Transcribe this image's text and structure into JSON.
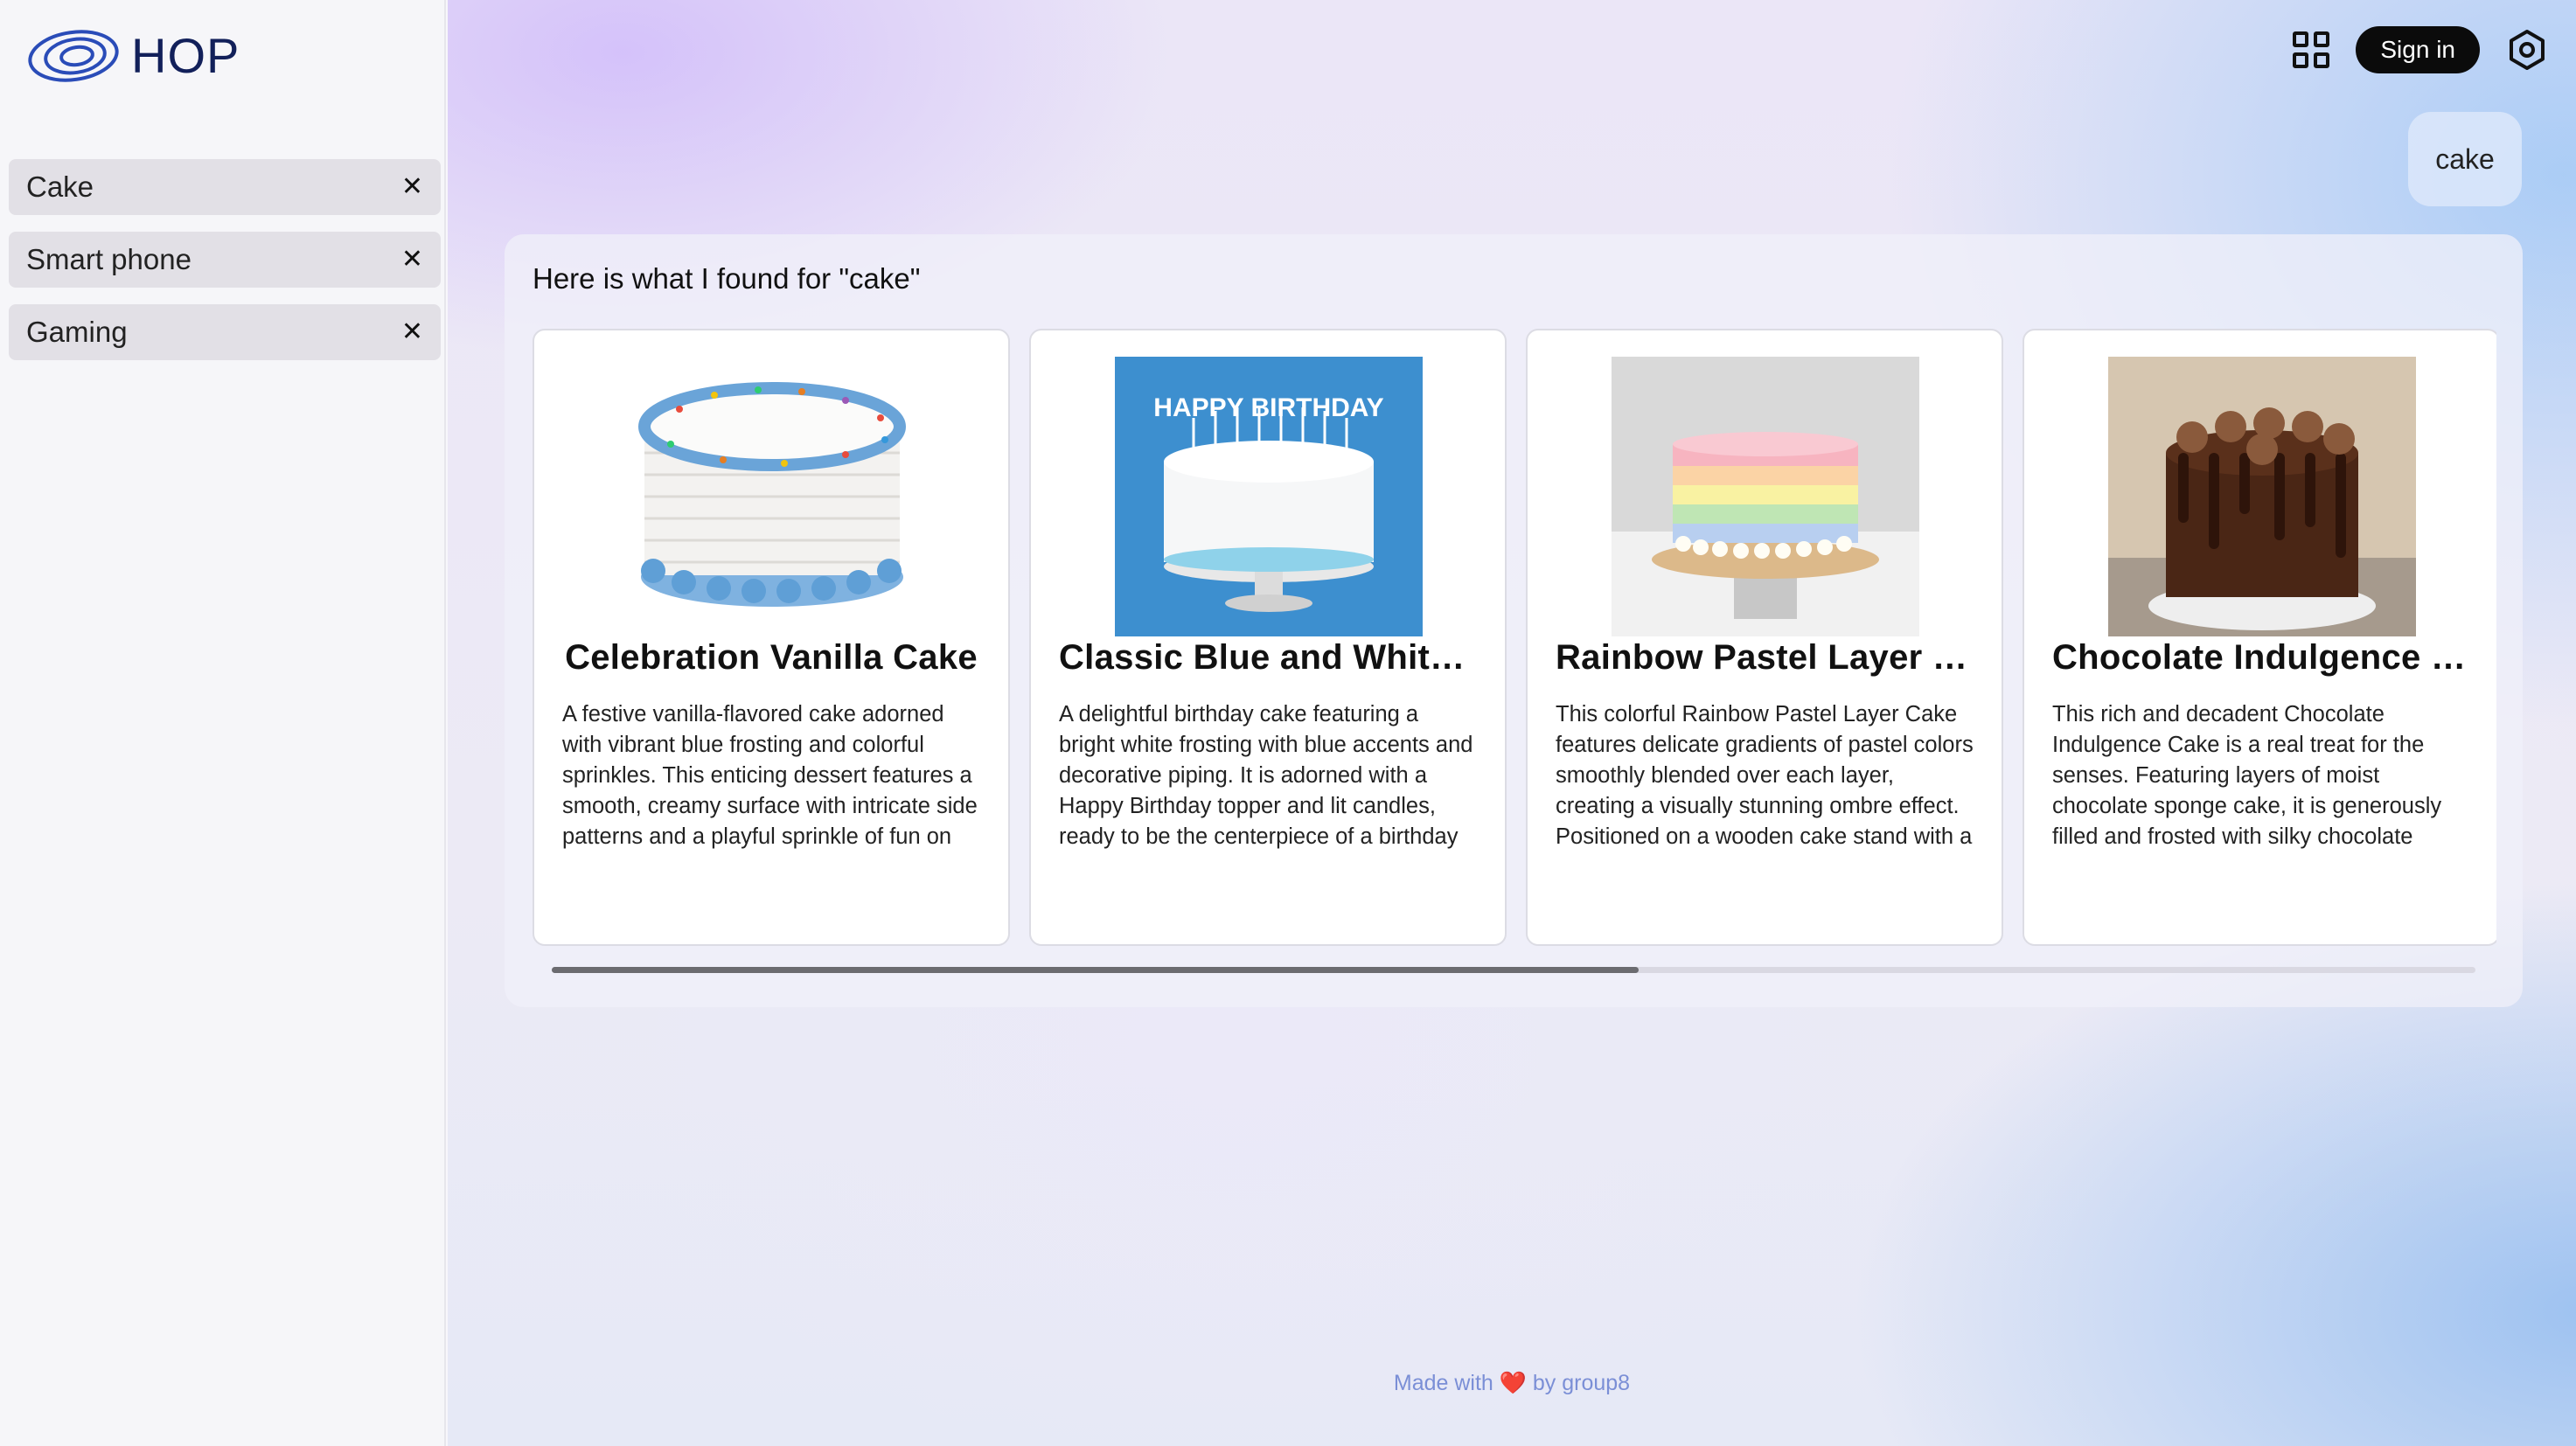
{
  "app": {
    "name": "HOP"
  },
  "sidebar": {
    "items": [
      {
        "label": "Cake",
        "close": "✕"
      },
      {
        "label": "Smart phone",
        "close": "✕"
      },
      {
        "label": "Gaming",
        "close": "✕"
      }
    ]
  },
  "header": {
    "sign_in_label": "Sign in",
    "icons": [
      "grid-icon",
      "settings-icon"
    ]
  },
  "chat": {
    "user_query": "cake",
    "response_heading": "Here is what I found for \"cake\"",
    "cards": [
      {
        "title": "Celebration Vanilla Cake",
        "description": "A festive vanilla-flavored cake adorned with vibrant blue frosting and colorful sprinkles. This enticing dessert features a smooth, creamy surface with intricate side patterns and a playful sprinkle of fun on the top edge. Perfect for any celebration"
      },
      {
        "title": "Classic Blue and White …",
        "image_text": "HAPPY BIRTHDAY",
        "description": "A delightful birthday cake featuring a bright white frosting with blue accents and decorative piping. It is adorned with a Happy Birthday topper and lit candles, ready to be the centerpiece of a birthday celebration. The cake is displayed on a"
      },
      {
        "title": "Rainbow Pastel Layer C…",
        "description": "This colorful Rainbow Pastel Layer Cake features delicate gradients of pastel colors smoothly blended over each layer, creating a visually stunning ombre effect. Positioned on a wooden cake stand with a modern grey base, the cake is adorned"
      },
      {
        "title": "Chocolate Indulgence C…",
        "description": "This rich and decadent Chocolate Indulgence Cake is a real treat for the senses. Featuring layers of moist chocolate sponge cake, it is generously filled and frosted with silky chocolate buttercream. The cake is elegantly"
      }
    ],
    "scroll_progress": 0.565
  },
  "footer": {
    "made_with": "Made with",
    "heart": "❤️",
    "by": "by group8"
  },
  "colors": {
    "accent": "#0b0b0b",
    "footer_text": "#7b8fd6",
    "logo": "#12205a"
  }
}
